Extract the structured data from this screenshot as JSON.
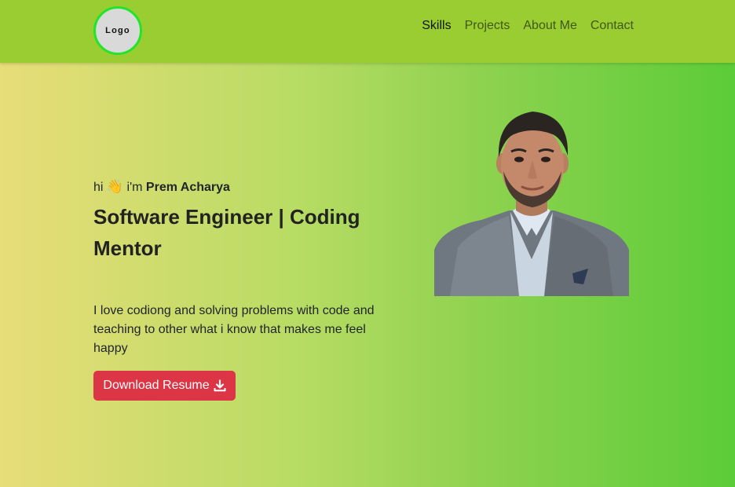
{
  "navbar": {
    "logo_text": "Logo",
    "links": [
      {
        "label": "Skills",
        "active": true
      },
      {
        "label": "Projects",
        "active": false
      },
      {
        "label": "About Me",
        "active": false
      },
      {
        "label": "Contact",
        "active": false
      }
    ]
  },
  "hero": {
    "greeting_prefix": "hi",
    "wave_emoji": "👋",
    "greeting_im": "i'm",
    "name": "Prem Acharya",
    "headline": "Software Engineer | Coding Mentor",
    "bio": "I love codiong and solving problems with code and teaching to other what i know that makes me feel happy",
    "resume_button": "Download Resume",
    "resume_icon": "download-icon"
  },
  "colors": {
    "navbar_bg": "#9acd32",
    "logo_border": "#22e52a",
    "button_bg": "#dc3545",
    "gradient_start": "#e8dd78",
    "gradient_end": "#5ccc38"
  }
}
